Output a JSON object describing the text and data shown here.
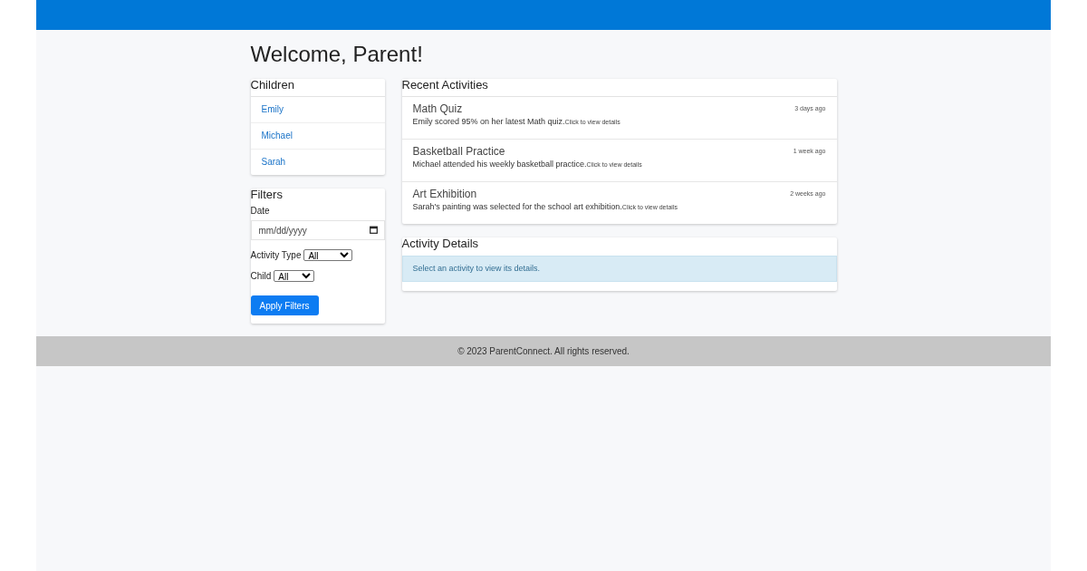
{
  "heading": "Welcome, Parent!",
  "children_panel": {
    "title": "Children",
    "items": [
      {
        "name": "Emily"
      },
      {
        "name": "Michael"
      },
      {
        "name": "Sarah"
      }
    ]
  },
  "filters": {
    "title": "Filters",
    "date_field": {
      "label": "Date",
      "placeholder": "mm/dd/yyyy"
    },
    "activity_type": {
      "label": "Activity Type",
      "value": "All"
    },
    "child": {
      "label": "Child",
      "value": "All"
    },
    "button": "Apply Filters"
  },
  "activities": {
    "title": "Recent Activities",
    "items": [
      {
        "title": "Math Quiz",
        "description": "Emily scored 95% on her latest Math quiz.",
        "link": "Click to view details",
        "time": "3 days ago"
      },
      {
        "title": "Basketball Practice",
        "description": "Michael attended his weekly basketball practice.",
        "link": "Click to view details",
        "time": "1 week ago"
      },
      {
        "title": "Art Exhibition",
        "description": "Sarah's painting was selected for the school art exhibition.",
        "link": "Click to view details",
        "time": "2 weeks ago"
      }
    ]
  },
  "details": {
    "title": "Activity Details",
    "message": "Select an activity to view its details."
  },
  "footer": "© 2023 ParentConnect. All rights reserved."
}
